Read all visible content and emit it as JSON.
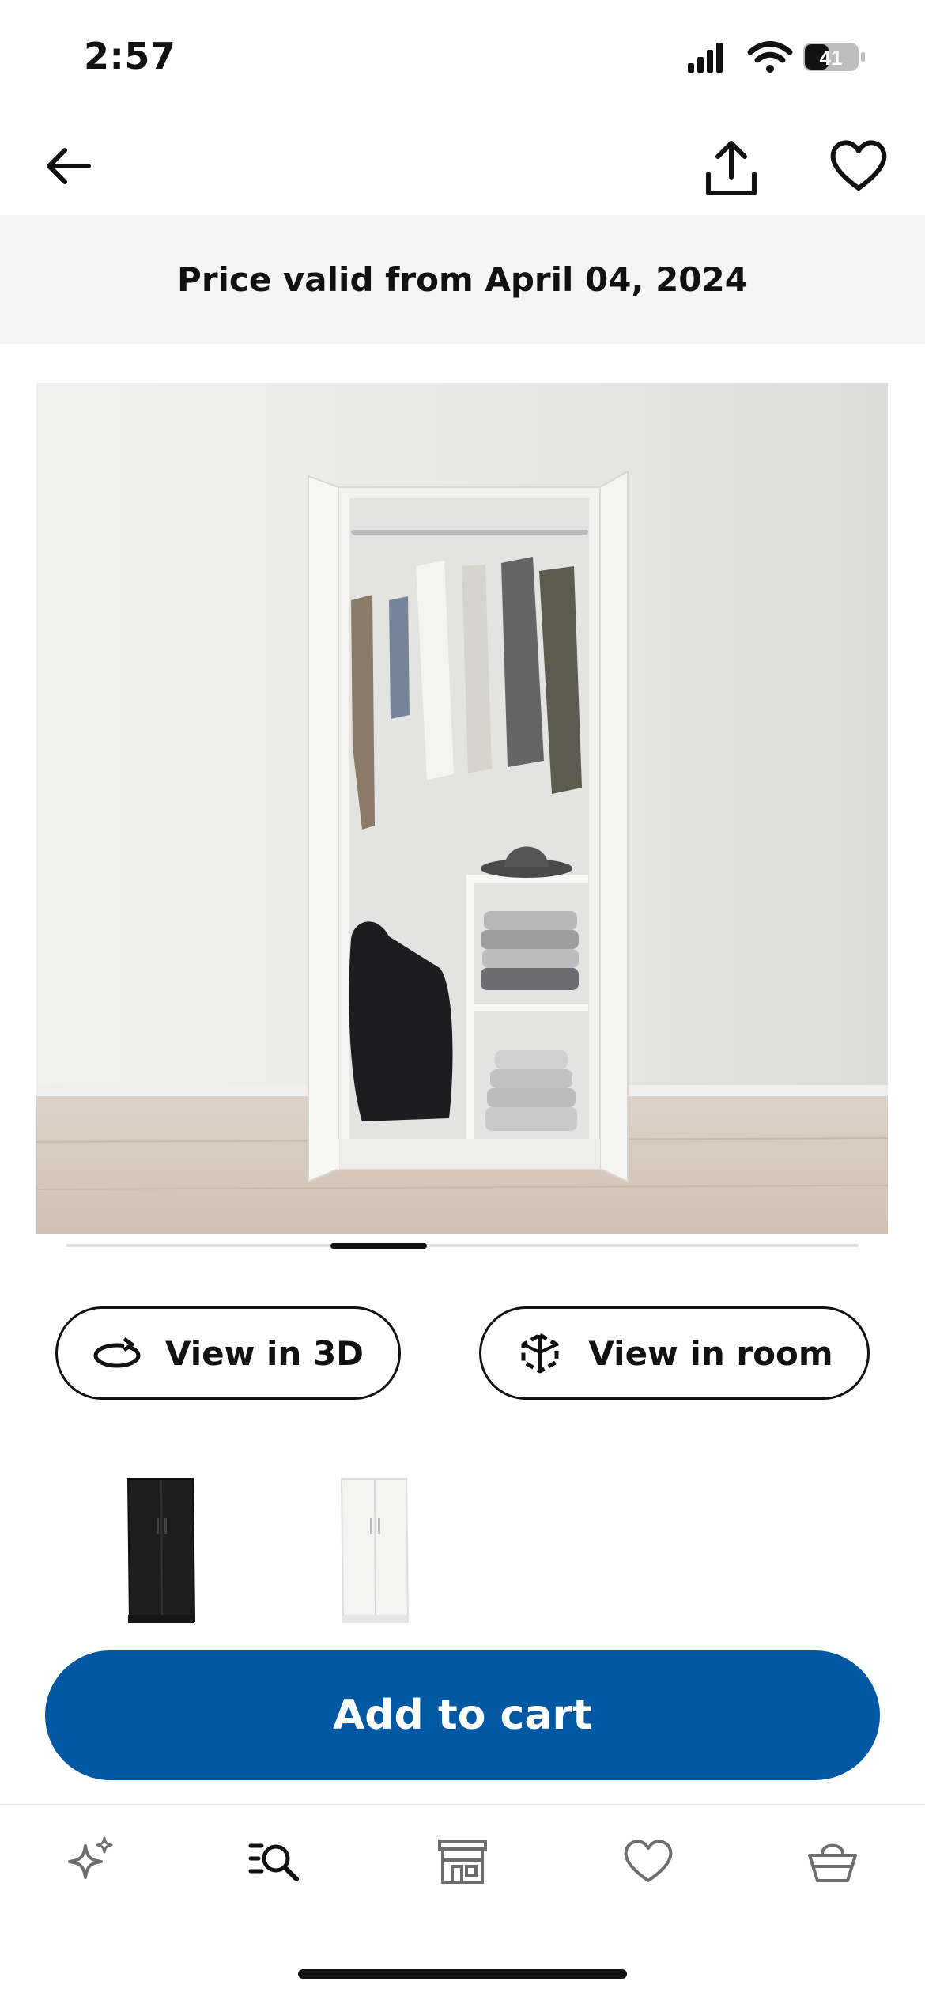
{
  "status_bar": {
    "time": "2:57",
    "battery": "41"
  },
  "price_banner": {
    "text": "Price valid from April 04, 2024"
  },
  "actions": {
    "view_3d": "View in 3D",
    "view_room": "View in room"
  },
  "variants": [
    {
      "name": "black",
      "color": "#1e1e1e"
    },
    {
      "name": "white",
      "color": "#f4f4f2"
    }
  ],
  "cart": {
    "label": "Add to cart",
    "color": "#0058a3"
  },
  "carousel": {
    "active_fraction": 0.38
  },
  "tabs": [
    {
      "icon": "sparkle-icon",
      "active": false
    },
    {
      "icon": "search-list-icon",
      "active": true
    },
    {
      "icon": "store-icon",
      "active": false
    },
    {
      "icon": "heart-icon",
      "active": false
    },
    {
      "icon": "basket-icon",
      "active": false
    }
  ]
}
